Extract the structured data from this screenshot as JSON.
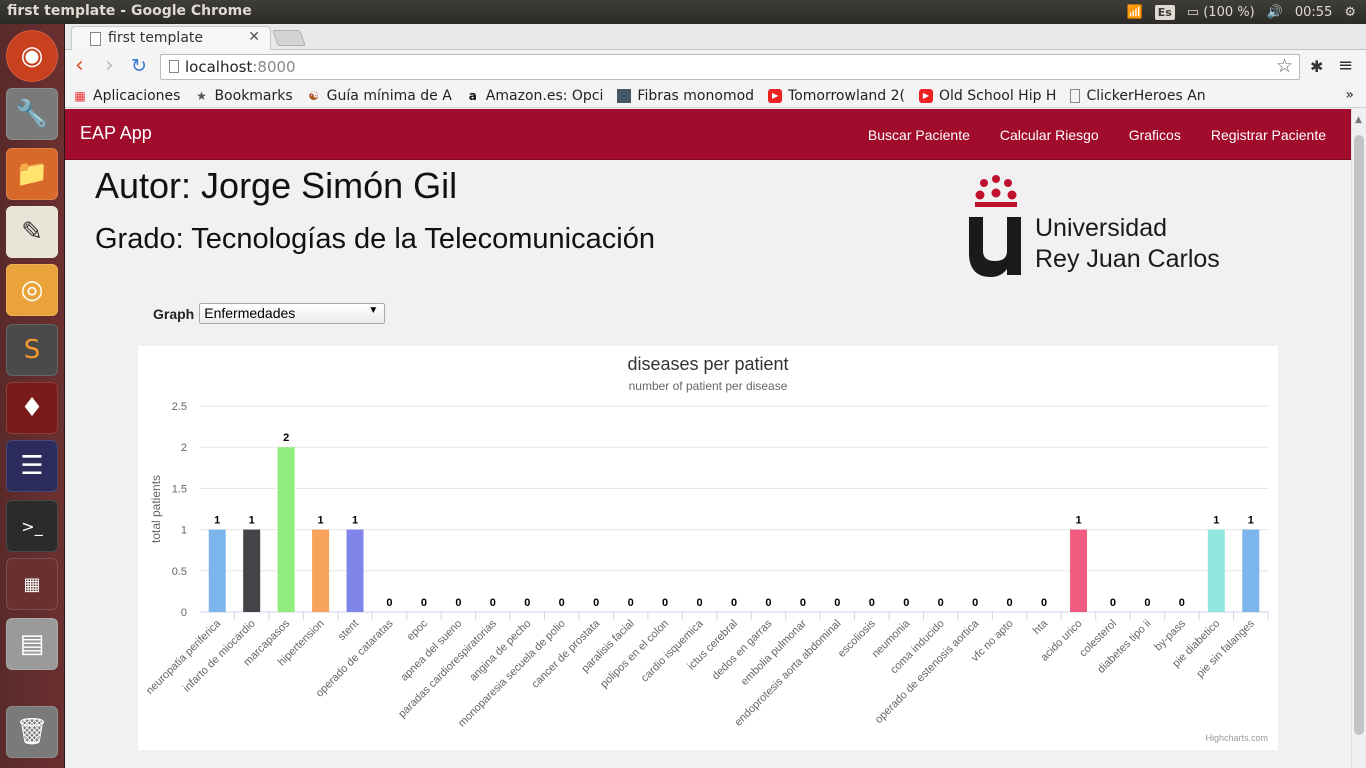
{
  "os": {
    "window_title": "first template - Google Chrome",
    "keyboard_layout": "Es",
    "battery": "(100 %)",
    "clock": "00:55"
  },
  "browser": {
    "tab_title": "first template",
    "url_host": "localhost",
    "url_port": ":8000",
    "bookmarks": [
      {
        "label": "Aplicaciones",
        "icon": "apps-grid-icon"
      },
      {
        "label": "Bookmarks",
        "icon": "star-icon"
      },
      {
        "label": "Guía mínima de A",
        "icon": "bookmark-site-icon"
      },
      {
        "label": "Amazon.es: Opci",
        "icon": "amazon-icon"
      },
      {
        "label": "Fibras monomod",
        "icon": "image-site-icon"
      },
      {
        "label": "Tomorrowland 2(",
        "icon": "youtube-icon"
      },
      {
        "label": "Old School Hip H",
        "icon": "youtube-icon"
      },
      {
        "label": "ClickerHeroes An",
        "icon": "page-icon"
      }
    ],
    "bookmarks_more": "»"
  },
  "app": {
    "brand": "EAP App",
    "nav": [
      "Buscar Paciente",
      "Calcular Riesgo",
      "Graficos",
      "Registrar Paciente"
    ],
    "author": "Autor: Jorge Simón Gil",
    "degree": "Grado: Tecnologías de la Telecomunicación",
    "logo_line1": "Universidad",
    "logo_line2": "Rey Juan Carlos",
    "graph_label": "Graph",
    "graph_selected": "Enfermedades",
    "credits": "Highcharts.com",
    "brand_color": "#a10b2c"
  },
  "chart_data": {
    "type": "bar",
    "title": "diseases per patient",
    "subtitle": "number of patient per disease",
    "ylabel": "total patients",
    "xlabel": "",
    "ylim": [
      0,
      2.5
    ],
    "yticks": [
      "0",
      "0.5",
      "1",
      "1.5",
      "2",
      "2.5"
    ],
    "grid": true,
    "categories": [
      "neuropatia periferica",
      "infarto de miocardio",
      "marcapasos",
      "hipertension",
      "stent",
      "operado de cataratas",
      "epoc",
      "apnea del sueno",
      "paradas cardiorespiratorias",
      "angina de pecho",
      "monoparesia secuela de polio",
      "cancer de prostata",
      "paralisis facial",
      "polipos en el colon",
      "cardio isquemica",
      "ictus cerebral",
      "dedos en garras",
      "embolia pulmonar",
      "endoprotesis aorta abdominal",
      "escoliosis",
      "neumonia",
      "coma inducido",
      "operado de estenosis aortica",
      "vfc no apto",
      "hta",
      "acido urico",
      "colesterol",
      "diabetes tipo ii",
      "by-pass",
      "pie diabetico",
      "pie sin falanges"
    ],
    "values": [
      1,
      1,
      2,
      1,
      1,
      0,
      0,
      0,
      0,
      0,
      0,
      0,
      0,
      0,
      0,
      0,
      0,
      0,
      0,
      0,
      0,
      0,
      0,
      0,
      0,
      1,
      0,
      0,
      0,
      1,
      1
    ],
    "colors": [
      "#7cb5ec",
      "#434348",
      "#90ed7d",
      "#f7a35c",
      "#8085e9",
      "#f15c80",
      "#e4d354",
      "#2b908f",
      "#f45b5b",
      "#91e8e1",
      "#7cb5ec",
      "#434348",
      "#90ed7d",
      "#f7a35c",
      "#8085e9",
      "#f15c80",
      "#e4d354",
      "#2b908f",
      "#f45b5b",
      "#91e8e1",
      "#7cb5ec",
      "#434348",
      "#90ed7d",
      "#f7a35c",
      "#8085e9",
      "#f15c80",
      "#e4d354",
      "#2b908f",
      "#f45b5b",
      "#91e8e1",
      "#7cb5ec"
    ]
  }
}
